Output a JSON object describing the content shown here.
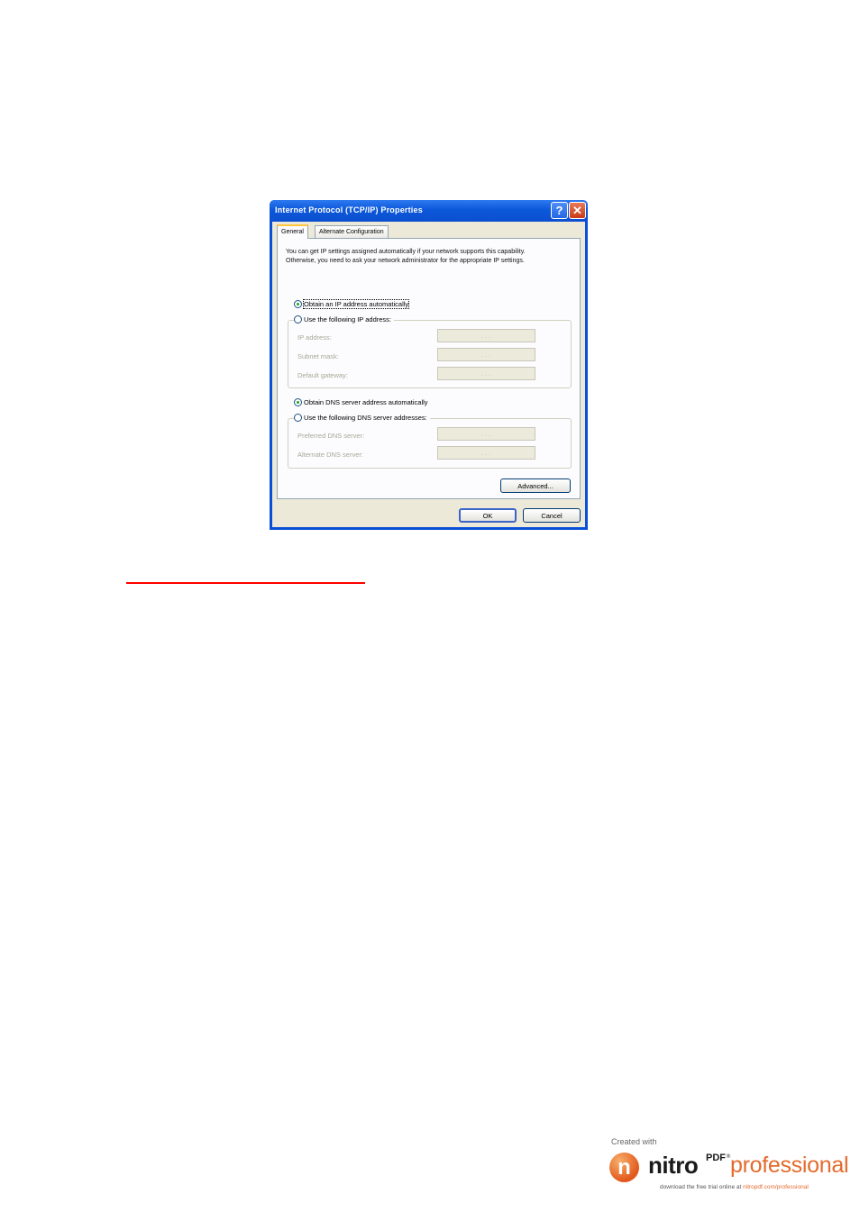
{
  "dialog": {
    "title": "Internet Protocol (TCP/IP) Properties",
    "help_glyph": "?",
    "close_glyph": "✕",
    "tabs": [
      {
        "label": "General",
        "selected": true
      },
      {
        "label": "Alternate Configuration",
        "selected": false
      }
    ],
    "description": "You can get IP settings assigned automatically if your network supports this capability. Otherwise, you need to ask your network administrator for the appropriate IP settings.",
    "ip": {
      "obtain_auto_label": "Obtain an IP address automatically",
      "obtain_auto_checked": true,
      "use_following_label": "Use the following IP address:",
      "use_following_checked": false,
      "fields": [
        {
          "label": "IP address:",
          "value": ". . ."
        },
        {
          "label": "Subnet mask:",
          "value": ". . ."
        },
        {
          "label": "Default gateway:",
          "value": ". . ."
        }
      ]
    },
    "dns": {
      "obtain_auto_label": "Obtain DNS server address automatically",
      "obtain_auto_checked": true,
      "use_following_label": "Use the following DNS server addresses:",
      "use_following_checked": false,
      "fields": [
        {
          "label": "Preferred DNS server:",
          "value": ". . ."
        },
        {
          "label": "Alternate DNS server:",
          "value": ". . ."
        }
      ]
    },
    "advanced_label": "Advanced...",
    "ok_label": "OK",
    "cancel_label": "Cancel"
  },
  "footer_logo": {
    "created_with": "Created with",
    "brand_n": "n",
    "brand_word": "nitro",
    "brand_pdf": "PDF",
    "brand_reg": "®",
    "brand_edition": "professional",
    "tagline_prefix": "download the free trial online at ",
    "tagline_link": "nitropdf.com/professional"
  },
  "colors": {
    "title_bar": "#0c58da",
    "dialog_face": "#ece9d8",
    "annotation_line": "#ff0000",
    "brand_orange": "#e36b2d"
  }
}
